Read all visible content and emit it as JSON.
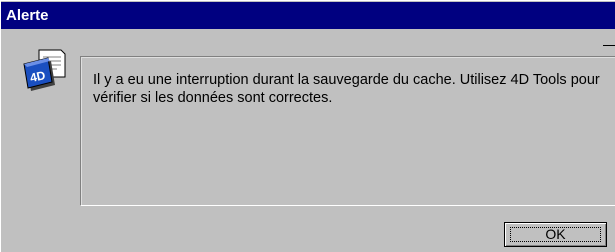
{
  "window": {
    "title": "Alerte"
  },
  "alert": {
    "icon": "4d-document-icon",
    "message": "Il y a eu une interruption durant la sauvegarde du cache. Utilisez 4D Tools pour vérifier si les données sont correctes."
  },
  "buttons": {
    "ok_label": "OK"
  },
  "colors": {
    "titlebar": "#000080",
    "dialog_background": "#c0c0c0"
  }
}
